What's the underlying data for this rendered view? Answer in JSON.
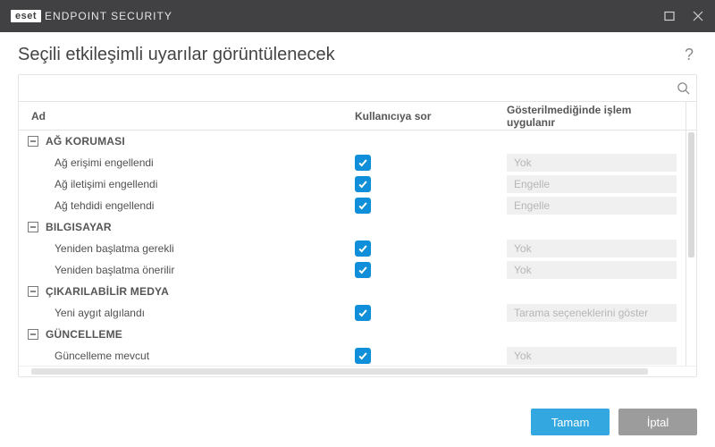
{
  "brand": {
    "box": "eset",
    "name": "ENDPOINT SECURITY"
  },
  "page": {
    "title": "Seçili etkileşimli uyarılar görüntülenecek"
  },
  "search": {
    "placeholder": ""
  },
  "columns": {
    "name": "Ad",
    "ask": "Kullanıcıya sor",
    "action": "Gösterilmediğinde işlem uygulanır"
  },
  "groups": [
    {
      "title": "AĞ KORUMASI",
      "items": [
        {
          "label": "Ağ erişimi engellendi",
          "ask": true,
          "action": "Yok"
        },
        {
          "label": "Ağ iletişimi engellendi",
          "ask": true,
          "action": "Engelle"
        },
        {
          "label": "Ağ tehdidi engellendi",
          "ask": true,
          "action": "Engelle"
        }
      ]
    },
    {
      "title": "BILGISAYAR",
      "items": [
        {
          "label": "Yeniden başlatma gerekli",
          "ask": true,
          "action": "Yok"
        },
        {
          "label": "Yeniden başlatma önerilir",
          "ask": true,
          "action": "Yok"
        }
      ]
    },
    {
      "title": "ÇIKARILABİLİR MEDYA",
      "items": [
        {
          "label": "Yeni aygıt algılandı",
          "ask": true,
          "action": "Tarama seçeneklerini göster"
        }
      ]
    },
    {
      "title": "GÜNCELLEME",
      "items": [
        {
          "label": "Güncelleme mevcut",
          "ask": true,
          "action": "Yok"
        }
      ]
    }
  ],
  "footer": {
    "ok": "Tamam",
    "cancel": "İptal"
  }
}
